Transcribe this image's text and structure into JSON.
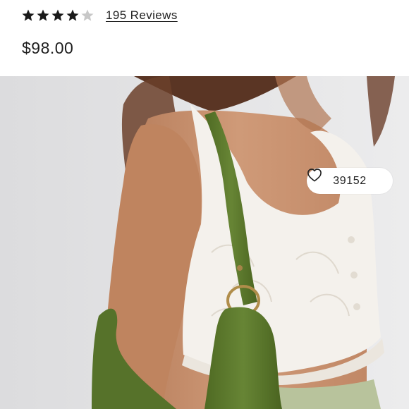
{
  "product": {
    "rating_value": 4,
    "rating_max": 5,
    "reviews_label": "195 Reviews",
    "price": "$98.00"
  },
  "image": {
    "alt": "Model wearing white ruffled lace crop top with green suede shoulder bag",
    "favorites_count": "39152"
  },
  "icons": {
    "star_filled": "star-filled-icon",
    "star_empty": "star-empty-icon",
    "favorite": "heart-outline-icon"
  },
  "colors": {
    "star_filled": "#1a1a1a",
    "star_empty": "#c8c8c8",
    "text": "#222222"
  }
}
